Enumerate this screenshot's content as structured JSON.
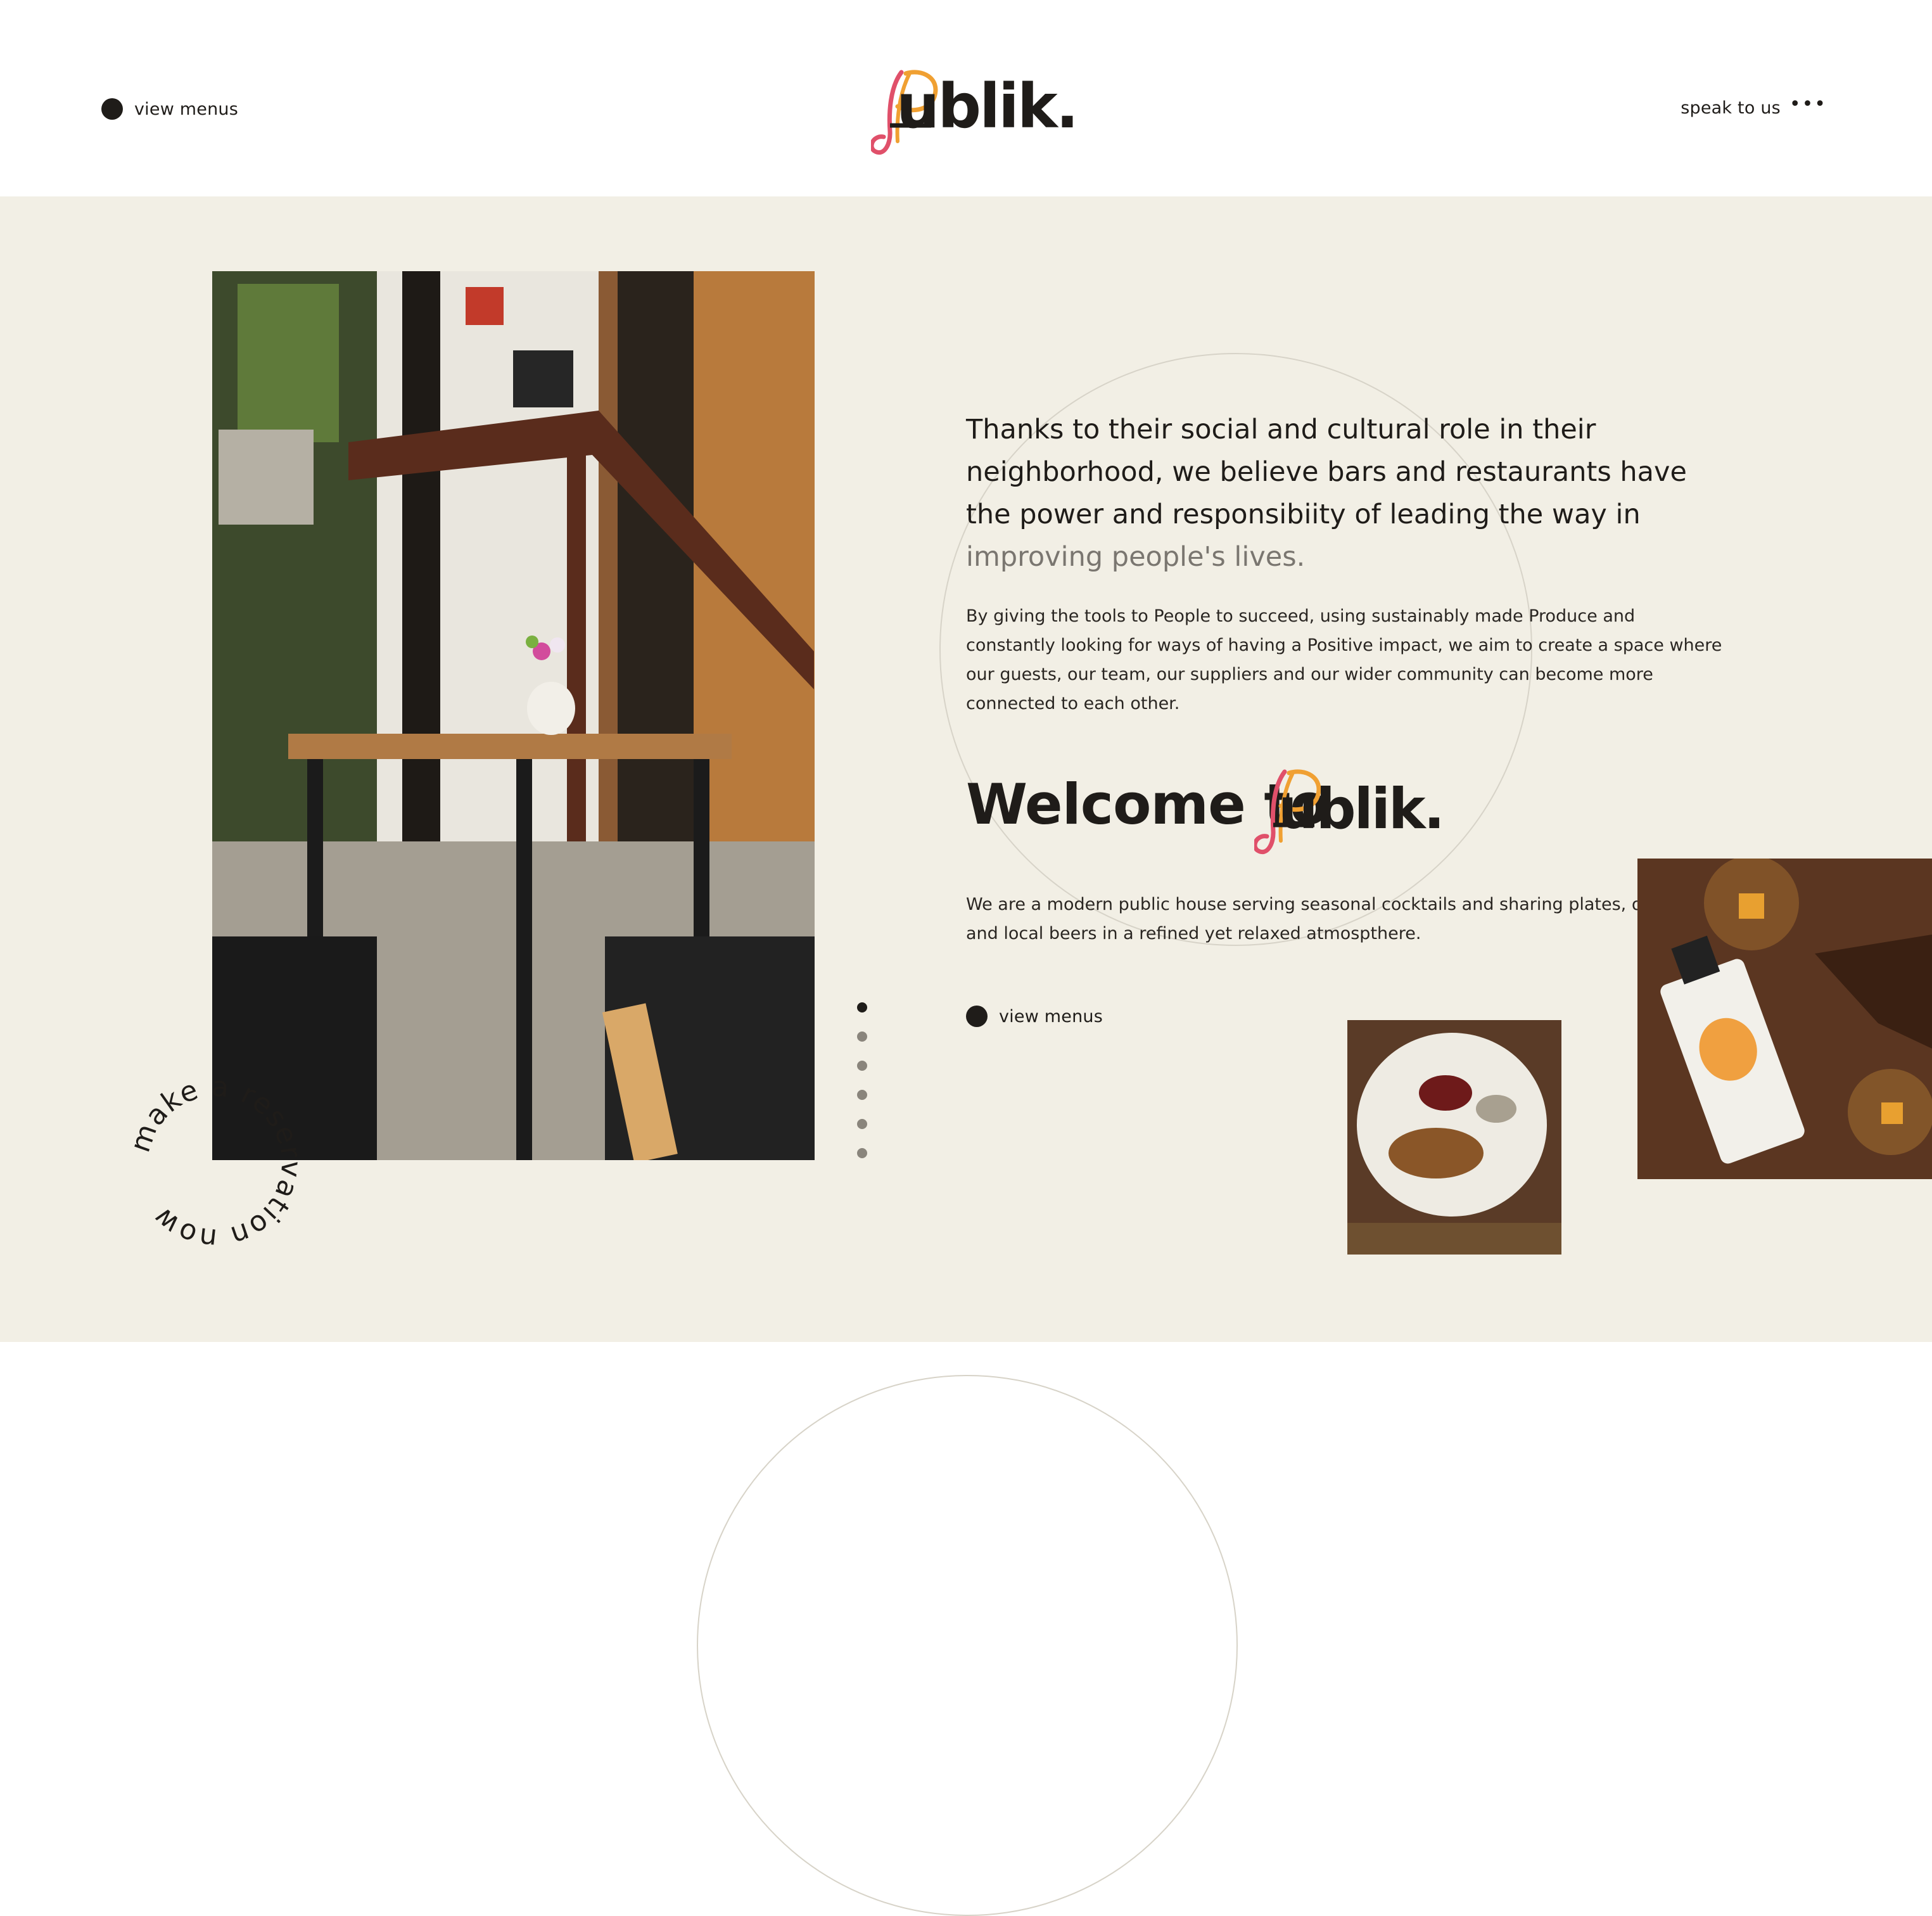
{
  "header": {
    "left_link": "view menus",
    "right_link": "speak to us",
    "right_icon": "more-dots-icon",
    "logo_text": "ublik."
  },
  "hero": {
    "lead_main": "Thanks to their social and cultural role in their neighborhood, we believe bars and restaurants have the power and responsibiity of leading the way in",
    "lead_muted": "improving people's lives.",
    "paragraph_1": "By giving the tools to People to succeed, using sustainably made Produce and constantly looking for ways of having a Positive impact, we aim to create a space where our guests, our team, our suppliers and our wider community can become more connected to each other.",
    "welcome_prefix": "Welcome to",
    "welcome_logo_text": "ublik.",
    "paragraph_2_line1": "We are a modern public house serving seasonal cocktails and sharing plates, orga",
    "paragraph_2_line2": "and local beers in a refined yet relaxed atmospthere.",
    "cta": "view menus",
    "slider": {
      "count": 6,
      "active": 1
    },
    "reservation_badge": "make a reservation now"
  },
  "colors": {
    "ink": "#1f1c19",
    "hero_bg": "#f2efe5",
    "logo_orange": "#f0a032",
    "logo_pink": "#e0506a"
  }
}
